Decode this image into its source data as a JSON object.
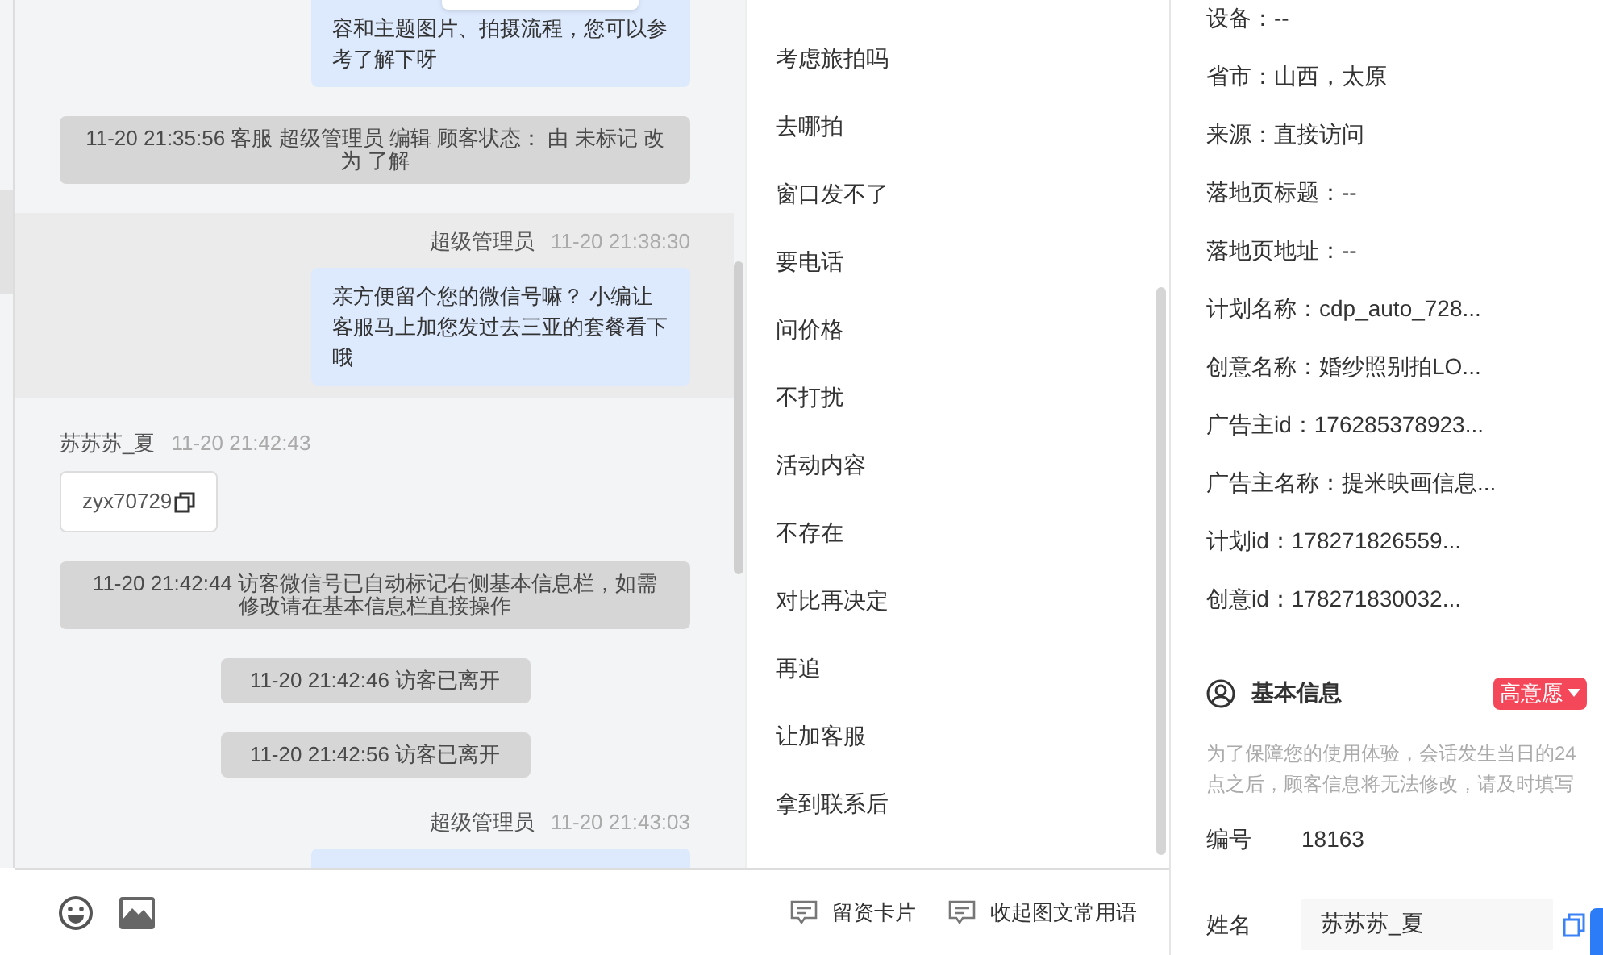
{
  "messages": [
    {
      "kind": "agent_bubble",
      "text": "容和主题图片、拍摄流程，您可以参考了解下呀"
    },
    {
      "kind": "system",
      "text": "11-20 21:35:56 客服 超级管理员 编辑 顾客状态： 由 未标记 改为 了解",
      "wide": true
    },
    {
      "kind": "agent",
      "sender": "超级管理员",
      "time": "11-20 21:38:30",
      "text": "亲方便留个您的微信号嘛？ 小编让客服马上加您发过去三亚的套餐看下哦",
      "selected": true
    },
    {
      "kind": "visitor",
      "sender": "苏苏苏_夏",
      "time": "11-20 21:42:43",
      "text": "zyx70729"
    },
    {
      "kind": "system",
      "text": "11-20 21:42:44 访客微信号已自动标记右侧基本信息栏，如需修改请在基本信息栏直接操作",
      "wide": true
    },
    {
      "kind": "system",
      "text": "11-20 21:42:46 访客已离开",
      "wide": false
    },
    {
      "kind": "system",
      "text": "11-20 21:42:56 访客已离开",
      "wide": false
    },
    {
      "kind": "agent_head",
      "sender": "超级管理员",
      "time": "11-20 21:43:03"
    }
  ],
  "phrases": [
    "考虑旅拍吗",
    "去哪拍",
    "窗口发不了",
    "要电话",
    "问价格",
    "不打扰",
    "活动内容",
    "不存在",
    "对比再决定",
    "再追",
    "让加客服",
    "拿到联系后"
  ],
  "toolbar": [
    "留资卡片",
    "收起图文常用语"
  ],
  "details": [
    "设备：--",
    "省市：山西，太原",
    "来源：直接访问",
    "落地页标题：--",
    "落地页地址：--",
    "计划名称：cdp_auto_728...",
    "创意名称：婚纱照别拍LO...",
    "广告主id：176285378923...",
    "广告主名称：提米映画信息...",
    "计划id：178271826559...",
    "创意id：178271830032..."
  ],
  "basic_info": {
    "title": "基本信息",
    "tag": "高意愿",
    "note": "为了保障您的使用体验，会话发生当日的24点之后，顾客信息将无法修改，请及时填写",
    "fields": [
      {
        "kind": "text",
        "label": "编号",
        "value": "18163"
      },
      {
        "kind": "input",
        "label": "姓名",
        "value": "苏苏苏_夏"
      }
    ]
  }
}
